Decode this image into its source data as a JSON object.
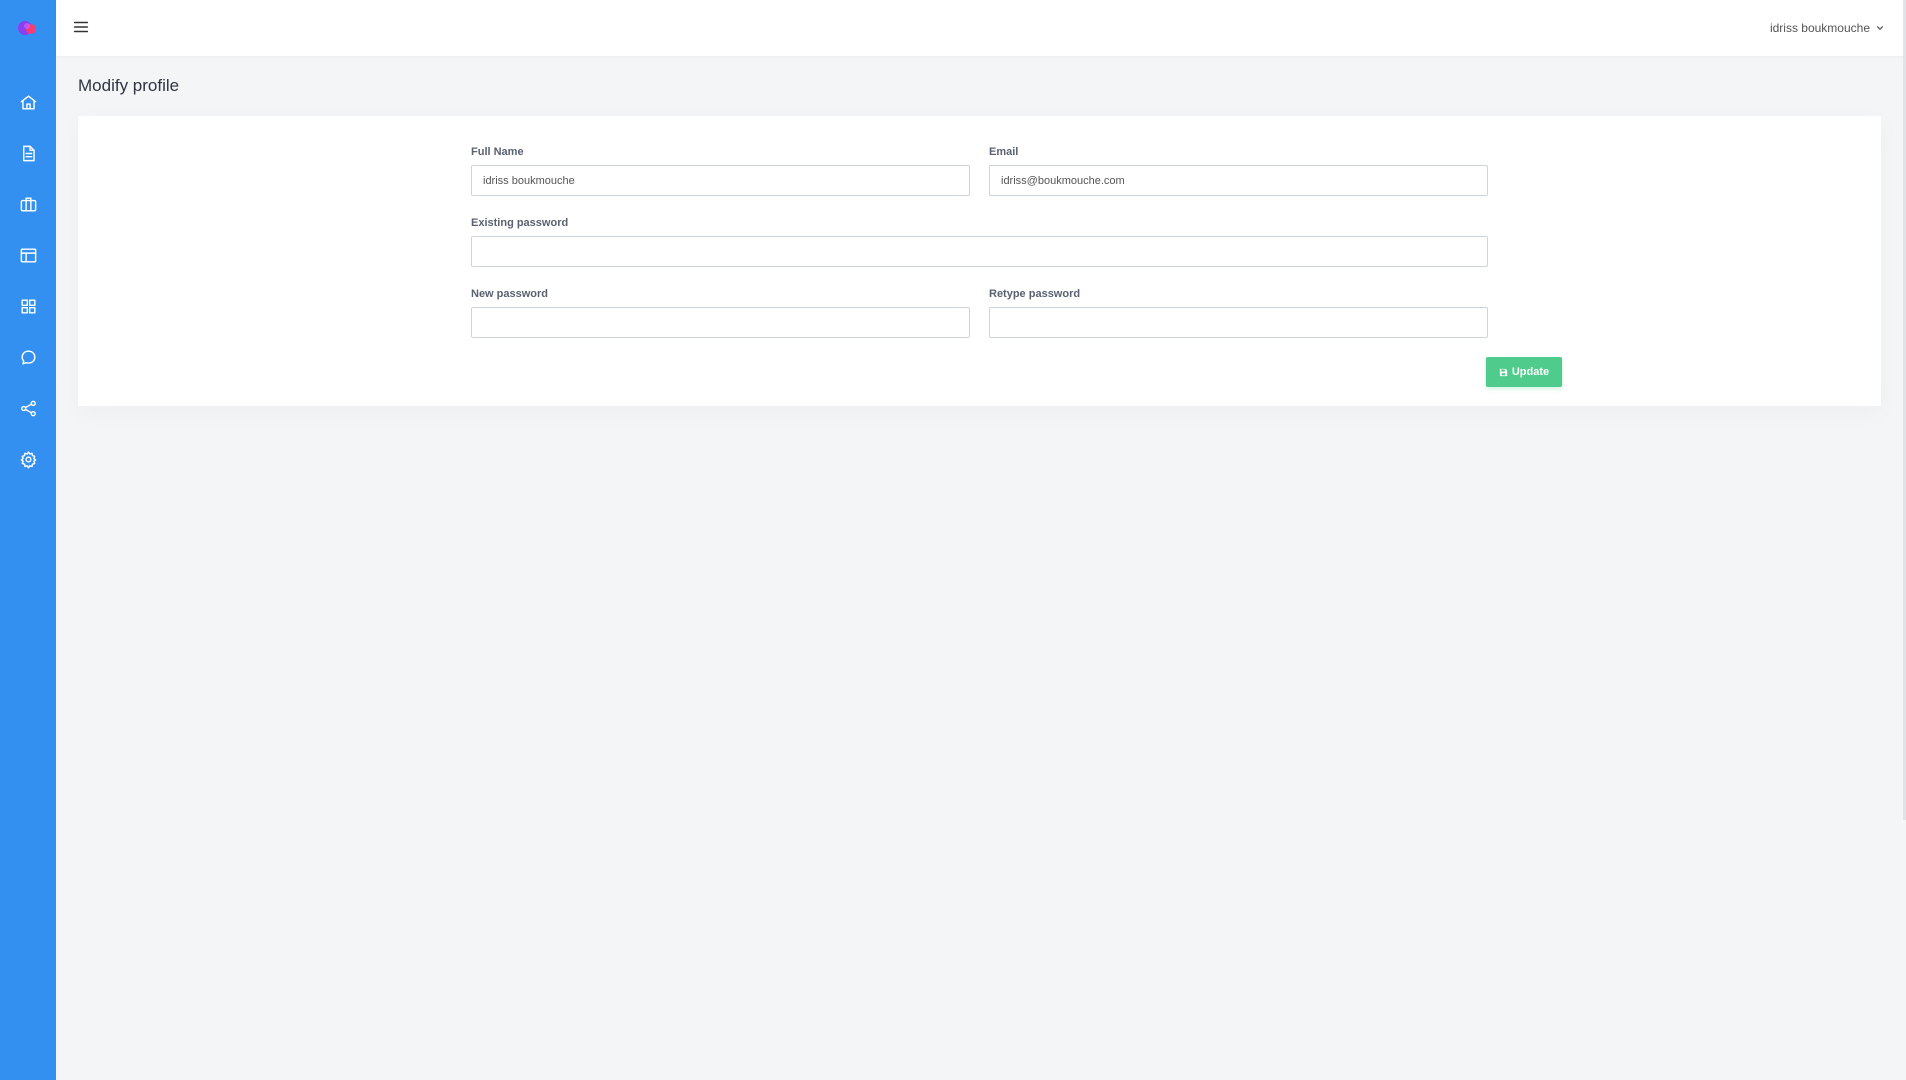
{
  "header": {
    "user_name": "idriss boukmouche"
  },
  "sidebar": {
    "items": [
      {
        "icon": "home-icon"
      },
      {
        "icon": "document-icon"
      },
      {
        "icon": "briefcase-icon"
      },
      {
        "icon": "layout-icon"
      },
      {
        "icon": "grid-icon"
      },
      {
        "icon": "chat-icon"
      },
      {
        "icon": "share-icon"
      },
      {
        "icon": "gear-icon"
      }
    ]
  },
  "page": {
    "title": "Modify profile"
  },
  "form": {
    "full_name_label": "Full Name",
    "full_name_value": "idriss boukmouche",
    "email_label": "Email",
    "email_value": "idriss@boukmouche.com",
    "existing_password_label": "Existing password",
    "existing_password_value": "",
    "new_password_label": "New password",
    "new_password_value": "",
    "retype_password_label": "Retype password",
    "retype_password_value": "",
    "update_label": "Update"
  },
  "colors": {
    "sidebar": "#3390f0",
    "button": "#4fcc8c",
    "background": "#f4f5f7"
  }
}
